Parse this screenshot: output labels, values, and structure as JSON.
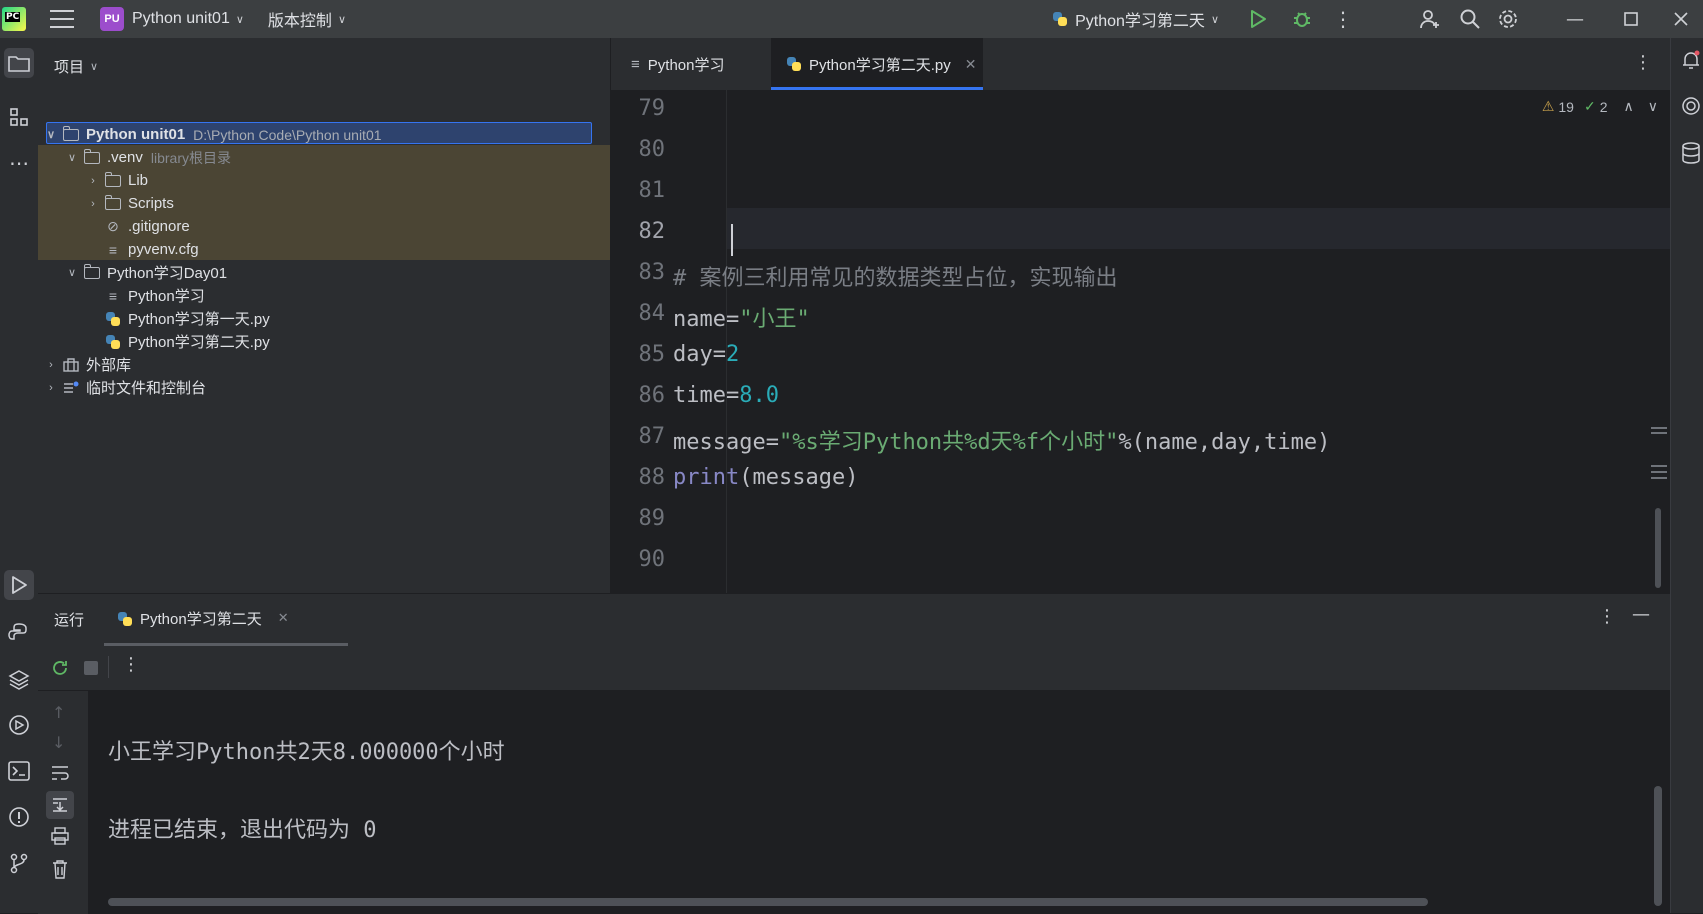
{
  "titlebar": {
    "project_badge": "PU",
    "project_name": "Python unit01",
    "vcs_label": "版本控制",
    "run_config": "Python学习第二天"
  },
  "project_panel": {
    "title": "项目",
    "tree": [
      {
        "label": "Python unit01",
        "hint": "D:\\Python Code\\Python unit01",
        "type": "folder",
        "expanded": true
      },
      {
        "label": ".venv",
        "hint": "library根目录",
        "type": "folder",
        "expanded": true
      },
      {
        "label": "Lib",
        "type": "folder",
        "expanded": false
      },
      {
        "label": "Scripts",
        "type": "folder",
        "expanded": false
      },
      {
        "label": ".gitignore",
        "type": "ignore"
      },
      {
        "label": "pyvenv.cfg",
        "type": "cfg"
      },
      {
        "label": "Python学习Day01",
        "type": "folder",
        "expanded": true
      },
      {
        "label": "Python学习",
        "type": "text"
      },
      {
        "label": "Python学习第一天.py",
        "type": "python"
      },
      {
        "label": "Python学习第二天.py",
        "type": "python"
      },
      {
        "label": "外部库",
        "type": "library",
        "expanded": false
      },
      {
        "label": "临时文件和控制台",
        "type": "scratch",
        "expanded": false
      }
    ]
  },
  "editor": {
    "tabs": [
      {
        "label": "Python学习",
        "active": false
      },
      {
        "label": "Python学习第二天.py",
        "active": true
      }
    ],
    "inspections": {
      "warnings": "19",
      "ok": "2"
    },
    "line_numbers": [
      "79",
      "80",
      "81",
      "82",
      "83",
      "84",
      "85",
      "86",
      "87",
      "88",
      "89",
      "90"
    ],
    "current_line": "82",
    "code": {
      "l83_comment": "# 案例三利用常见的数据类型占位，实现输出",
      "l84_name": "name",
      "l84_eq": "=",
      "l84_str": "\"小王\"",
      "l85_name": "day",
      "l85_eq": "=",
      "l85_num": "2",
      "l86_name": "time",
      "l86_eq": "=",
      "l86_num": "8.0",
      "l87_name": "message",
      "l87_eq": "=",
      "l87_str": "\"%s学习Python共%d天%f个小时\"",
      "l87_rest": "%(name,day,time)",
      "l88_fn": "print",
      "l88_rest": "(message)"
    }
  },
  "run_panel": {
    "title": "运行",
    "tab_label": "Python学习第二天",
    "output": [
      "小王学习Python共2天8.000000个小时",
      "进程已结束，退出代码为 0"
    ]
  },
  "colors": {
    "accent": "#3574f0",
    "string": "#6aab73",
    "number": "#2aacb8",
    "comment": "#7a7e85",
    "builtin": "#8888c6",
    "run_green": "#5fb865"
  }
}
